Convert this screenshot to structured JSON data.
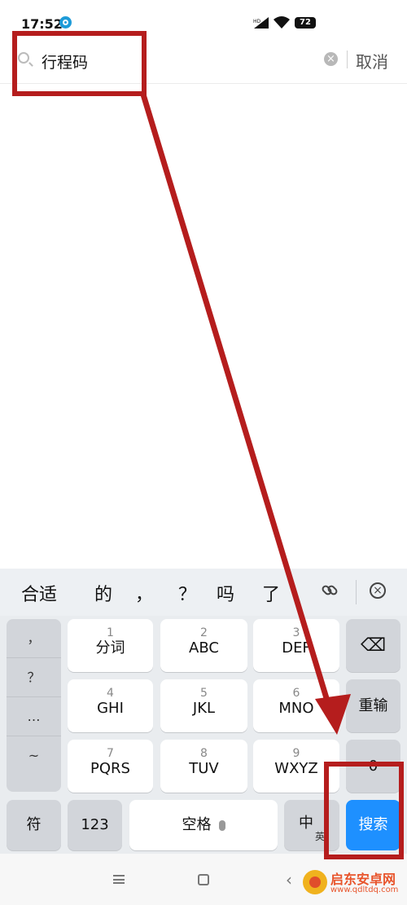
{
  "status": {
    "time": "17:52",
    "network": "HD",
    "battery": "72"
  },
  "search": {
    "query": "行程码",
    "cancel_label": "取消",
    "clear_symbol": "×"
  },
  "candidates": [
    "合适",
    "的",
    "，",
    "？",
    "吗",
    "了"
  ],
  "candidate_close_symbol": "×",
  "keyboard": {
    "symbols": [
      "，",
      "？",
      "…",
      "~"
    ],
    "keys": [
      {
        "num": "1",
        "label": "分词"
      },
      {
        "num": "2",
        "label": "ABC"
      },
      {
        "num": "3",
        "label": "DEF"
      },
      {
        "num": "4",
        "label": "GHI"
      },
      {
        "num": "5",
        "label": "JKL"
      },
      {
        "num": "6",
        "label": "MNO"
      },
      {
        "num": "7",
        "label": "PQRS"
      },
      {
        "num": "8",
        "label": "TUV"
      },
      {
        "num": "9",
        "label": "WXYZ"
      }
    ],
    "backspace": "⌫",
    "retype": "重输",
    "zero": "0",
    "sym_key": "符",
    "num_key": "123",
    "space_key": "空格",
    "lang_main": "中",
    "lang_sub": "英",
    "search_key": "搜索"
  },
  "watermark": {
    "name": "启东安卓网",
    "url": "www.qdltdq.com"
  },
  "colors": {
    "accent": "#1e90ff",
    "annotation": "#b51d1d"
  }
}
